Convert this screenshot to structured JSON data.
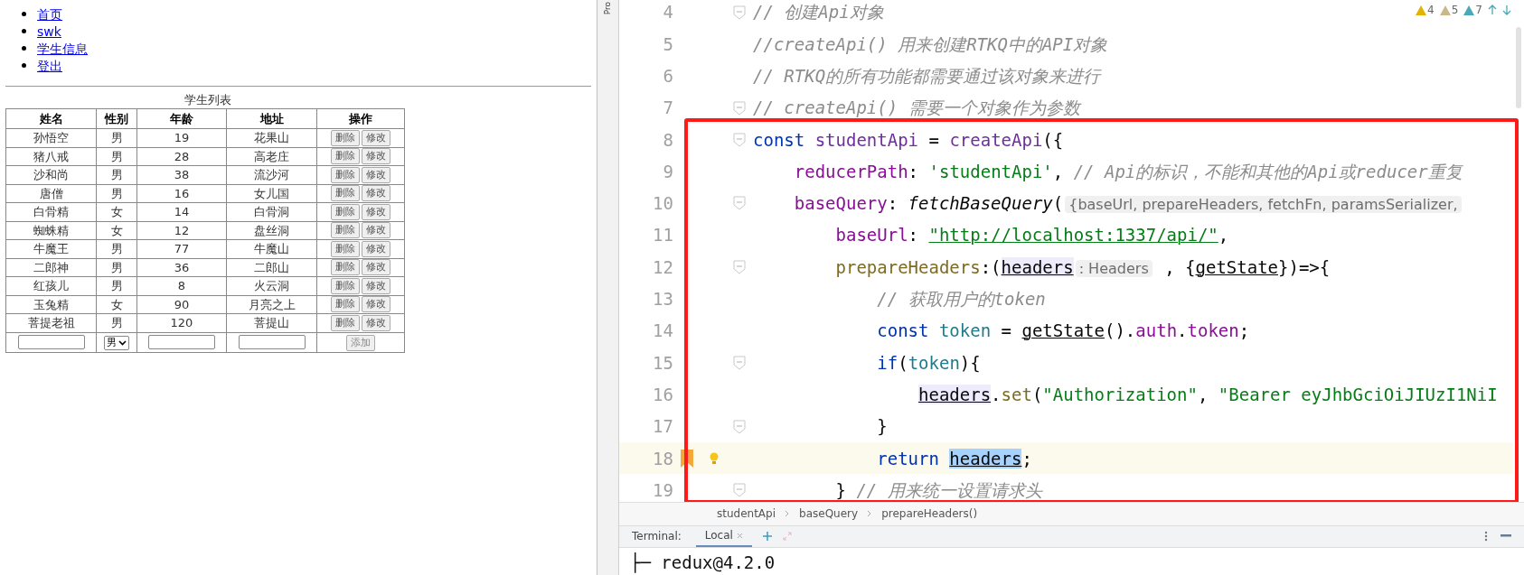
{
  "web_page": {
    "nav_links": [
      "首页",
      "swk",
      "学生信息",
      "登出"
    ],
    "table": {
      "caption": "学生列表",
      "columns": [
        "姓名",
        "性别",
        "年龄",
        "地址",
        "操作"
      ],
      "rows": [
        {
          "name": "孙悟空",
          "gender": "男",
          "age": "19",
          "address": "花果山",
          "actions": [
            "删除",
            "修改"
          ]
        },
        {
          "name": "猪八戒",
          "gender": "男",
          "age": "28",
          "address": "高老庄",
          "actions": [
            "删除",
            "修改"
          ]
        },
        {
          "name": "沙和尚",
          "gender": "男",
          "age": "38",
          "address": "流沙河",
          "actions": [
            "删除",
            "修改"
          ]
        },
        {
          "name": "唐僧",
          "gender": "男",
          "age": "16",
          "address": "女儿国",
          "actions": [
            "删除",
            "修改"
          ]
        },
        {
          "name": "白骨精",
          "gender": "女",
          "age": "14",
          "address": "白骨洞",
          "actions": [
            "删除",
            "修改"
          ]
        },
        {
          "name": "蜘蛛精",
          "gender": "女",
          "age": "12",
          "address": "盘丝洞",
          "actions": [
            "删除",
            "修改"
          ]
        },
        {
          "name": "牛魔王",
          "gender": "男",
          "age": "77",
          "address": "牛魔山",
          "actions": [
            "删除",
            "修改"
          ]
        },
        {
          "name": "二郎神",
          "gender": "男",
          "age": "36",
          "address": "二郎山",
          "actions": [
            "删除",
            "修改"
          ]
        },
        {
          "name": "红孩儿",
          "gender": "男",
          "age": "8",
          "address": "火云洞",
          "actions": [
            "删除",
            "修改"
          ]
        },
        {
          "name": "玉兔精",
          "gender": "女",
          "age": "90",
          "address": "月亮之上",
          "actions": [
            "删除",
            "修改"
          ]
        },
        {
          "name": "菩提老祖",
          "gender": "男",
          "age": "120",
          "address": "菩提山",
          "actions": [
            "删除",
            "修改"
          ]
        }
      ],
      "add_row": {
        "gender": "男",
        "button": "添加"
      }
    }
  },
  "ide": {
    "tool_strip_label": "Pro",
    "inspections": [
      {
        "kind": "warning",
        "count": "4"
      },
      {
        "kind": "weak",
        "count": "5"
      },
      {
        "kind": "typo",
        "count": "7"
      }
    ],
    "lines": [
      {
        "number": "4",
        "fold": true,
        "current": false,
        "bookmarked": false,
        "bulb": false,
        "tokens": [
          {
            "kind": "comment",
            "text": "// 创建Api对象"
          }
        ]
      },
      {
        "number": "5",
        "fold": false,
        "current": false,
        "bookmarked": false,
        "bulb": false,
        "tokens": [
          {
            "kind": "comment",
            "text": "//createApi() 用来创建RTKQ中的API对象"
          }
        ]
      },
      {
        "number": "6",
        "fold": false,
        "current": false,
        "bookmarked": false,
        "bulb": false,
        "tokens": [
          {
            "kind": "comment",
            "text": "// RTKQ的所有功能都需要通过该对象来进行"
          }
        ]
      },
      {
        "number": "7",
        "fold": true,
        "current": false,
        "bookmarked": false,
        "bulb": false,
        "tokens": [
          {
            "kind": "comment",
            "text": "// createApi() 需要一个对象作为参数"
          }
        ]
      },
      {
        "number": "8",
        "fold": true,
        "current": false,
        "bookmarked": false,
        "bulb": false,
        "tokens": [
          {
            "kind": "keyword",
            "text": "const "
          },
          {
            "kind": "variable",
            "text": "studentApi"
          },
          {
            "kind": "plain",
            "text": " = "
          },
          {
            "kind": "variable",
            "text": "createApi"
          },
          {
            "kind": "plain",
            "text": "({"
          }
        ]
      },
      {
        "number": "9",
        "fold": false,
        "current": false,
        "bookmarked": false,
        "bulb": false,
        "tokens": [
          {
            "kind": "property",
            "text": "    reducerPath"
          },
          {
            "kind": "plain",
            "text": ": "
          },
          {
            "kind": "string",
            "text": "'studentApi'"
          },
          {
            "kind": "plain",
            "text": ", "
          },
          {
            "kind": "comment",
            "text": "// Api的标识，不能和其他的Api或reducer重复"
          }
        ]
      },
      {
        "number": "10",
        "fold": true,
        "current": false,
        "bookmarked": false,
        "bulb": false,
        "tokens": [
          {
            "kind": "property",
            "text": "    baseQuery"
          },
          {
            "kind": "plain",
            "text": ": "
          },
          {
            "kind": "call",
            "text": "fetchBaseQuery"
          },
          {
            "kind": "plain",
            "text": "("
          },
          {
            "kind": "hint",
            "text": "{baseUrl, prepareHeaders, fetchFn, paramsSerializer,"
          }
        ]
      },
      {
        "number": "11",
        "fold": false,
        "current": false,
        "bookmarked": false,
        "bulb": false,
        "tokens": [
          {
            "kind": "property",
            "text": "        baseUrl"
          },
          {
            "kind": "plain",
            "text": ": "
          },
          {
            "kind": "url",
            "text": "\"http://localhost:1337/api/\""
          },
          {
            "kind": "plain",
            "text": ","
          }
        ]
      },
      {
        "number": "12",
        "fold": true,
        "current": false,
        "bookmarked": false,
        "bulb": false,
        "tokens": [
          {
            "kind": "method",
            "text": "        prepareHeaders"
          },
          {
            "kind": "plain",
            "text": ":("
          },
          {
            "kind": "reference",
            "text": "headers"
          },
          {
            "kind": "hint",
            "text": ": Headers"
          },
          {
            "kind": "plain",
            "text": " , {"
          },
          {
            "kind": "underlined",
            "text": "getState"
          },
          {
            "kind": "plain",
            "text": "})=>{"
          }
        ]
      },
      {
        "number": "13",
        "fold": false,
        "current": false,
        "bookmarked": false,
        "bulb": false,
        "tokens": [
          {
            "kind": "comment",
            "text": "            // 获取用户的token"
          }
        ]
      },
      {
        "number": "14",
        "fold": false,
        "current": false,
        "bookmarked": false,
        "bulb": false,
        "tokens": [
          {
            "kind": "keyword",
            "text": "            const "
          },
          {
            "kind": "local",
            "text": "token"
          },
          {
            "kind": "plain",
            "text": " = "
          },
          {
            "kind": "underlined",
            "text": "getState"
          },
          {
            "kind": "plain",
            "text": "()."
          },
          {
            "kind": "property",
            "text": "auth"
          },
          {
            "kind": "plain",
            "text": "."
          },
          {
            "kind": "property",
            "text": "token"
          },
          {
            "kind": "plain",
            "text": ";"
          }
        ]
      },
      {
        "number": "15",
        "fold": true,
        "current": false,
        "bookmarked": false,
        "bulb": false,
        "tokens": [
          {
            "kind": "keyword",
            "text": "            if"
          },
          {
            "kind": "plain",
            "text": "("
          },
          {
            "kind": "local",
            "text": "token"
          },
          {
            "kind": "plain",
            "text": "){"
          }
        ]
      },
      {
        "number": "16",
        "fold": false,
        "current": false,
        "bookmarked": false,
        "bulb": false,
        "tokens": [
          {
            "kind": "reference",
            "text": "                headers"
          },
          {
            "kind": "plain",
            "text": "."
          },
          {
            "kind": "method",
            "text": "set"
          },
          {
            "kind": "plain",
            "text": "("
          },
          {
            "kind": "string",
            "text": "\"Authorization\""
          },
          {
            "kind": "plain",
            "text": ", "
          },
          {
            "kind": "string",
            "text": "\"Bearer eyJhbGciOiJIUzI1NiI"
          }
        ]
      },
      {
        "number": "17",
        "fold": true,
        "current": false,
        "bookmarked": false,
        "bulb": false,
        "tokens": [
          {
            "kind": "plain",
            "text": "            }"
          }
        ]
      },
      {
        "number": "18",
        "fold": false,
        "current": true,
        "bookmarked": true,
        "bulb": true,
        "tokens": [
          {
            "kind": "keyword",
            "text": "            return "
          },
          {
            "kind": "match",
            "text": "headers"
          },
          {
            "kind": "plain",
            "text": ";"
          }
        ]
      },
      {
        "number": "19",
        "fold": true,
        "current": false,
        "bookmarked": false,
        "bulb": false,
        "tokens": [
          {
            "kind": "plain",
            "text": "        } "
          },
          {
            "kind": "comment",
            "text": "// 用来统一设置请求头"
          }
        ]
      }
    ],
    "breadcrumbs": [
      "studentApi",
      "baseQuery",
      "prepareHeaders()"
    ],
    "terminal": {
      "label": "Terminal:",
      "tabs": [
        {
          "label": "Local",
          "selected": true
        }
      ],
      "output": "├─ redux@4.2.0"
    }
  }
}
